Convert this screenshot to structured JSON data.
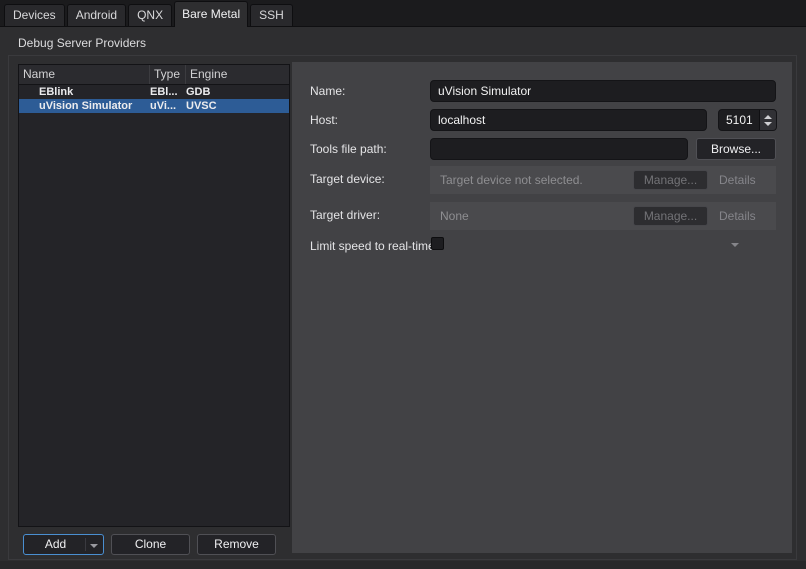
{
  "tabs": [
    {
      "label": "Devices",
      "active": false
    },
    {
      "label": "Android",
      "active": false
    },
    {
      "label": "QNX",
      "active": false
    },
    {
      "label": "Bare Metal",
      "active": true
    },
    {
      "label": "SSH",
      "active": false
    }
  ],
  "group_box": {
    "title": "Debug Server Providers"
  },
  "provider_table": {
    "columns": [
      "Name",
      "Type",
      "Engine"
    ],
    "rows": [
      {
        "name": "EBlink",
        "type": "EBl...",
        "engine": "GDB",
        "selected": false
      },
      {
        "name": "uVision Simulator",
        "type": "uVi...",
        "engine": "UVSC",
        "selected": true
      }
    ]
  },
  "actions": {
    "add": "Add",
    "clone": "Clone",
    "remove": "Remove"
  },
  "form": {
    "name_label": "Name:",
    "name_value": "uVision Simulator",
    "host_label": "Host:",
    "host_value": "localhost",
    "port_value": "5101",
    "tools_label": "Tools file path:",
    "tools_value": "",
    "browse_label": "Browse...",
    "target_device_label": "Target device:",
    "target_device_value": "Target device not selected.",
    "target_driver_label": "Target driver:",
    "target_driver_value": "None",
    "manage_label": "Manage...",
    "details_label": "Details",
    "limit_label": "Limit speed to real-time:",
    "limit_checked": false
  },
  "colors": {
    "selection": "#2d5c96",
    "focus_border": "#4a8fd1",
    "panel_bg": "#424245",
    "pane_bg": "#2e2e30",
    "input_bg": "#1d1d20"
  }
}
